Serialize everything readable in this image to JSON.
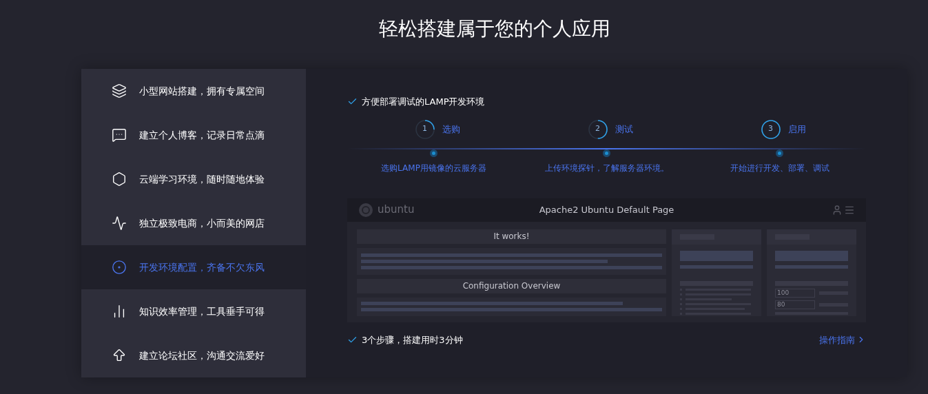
{
  "title": "轻松搭建属于您的个人应用",
  "menu": [
    {
      "label": "小型网站搭建，拥有专属空间",
      "selected": false
    },
    {
      "label": "建立个人博客，记录日常点滴",
      "selected": false
    },
    {
      "label": "云端学习环境，随时随地体验",
      "selected": false
    },
    {
      "label": "独立极致电商，小而美的网店",
      "selected": false
    },
    {
      "label": "开发环境配置，齐备不欠东风",
      "selected": true
    },
    {
      "label": "知识效率管理，工具垂手可得",
      "selected": false
    },
    {
      "label": "建立论坛社区，沟通交流爱好",
      "selected": false
    }
  ],
  "headline": "方便部署调试的LAMP开发环境",
  "steps": [
    {
      "number": "1",
      "name": "选购",
      "kind": "quarter",
      "description": "选购LAMP用镜像的云服务器"
    },
    {
      "number": "2",
      "name": "测试",
      "kind": "half",
      "description": "上传环境探针，了解服务器环境。"
    },
    {
      "number": "3",
      "name": "启用",
      "kind": "full",
      "description": "开始进行开发、部署、调试"
    }
  ],
  "preview": {
    "logo": "ubuntu",
    "title": "Apache2 Ubuntu Default Page",
    "section_1": "It works!",
    "section_2": "Configuration Overview",
    "field_1": "100",
    "field_2": "80"
  },
  "summary": "3个步骤，搭建用时3分钟",
  "guide_link": "操作指南"
}
